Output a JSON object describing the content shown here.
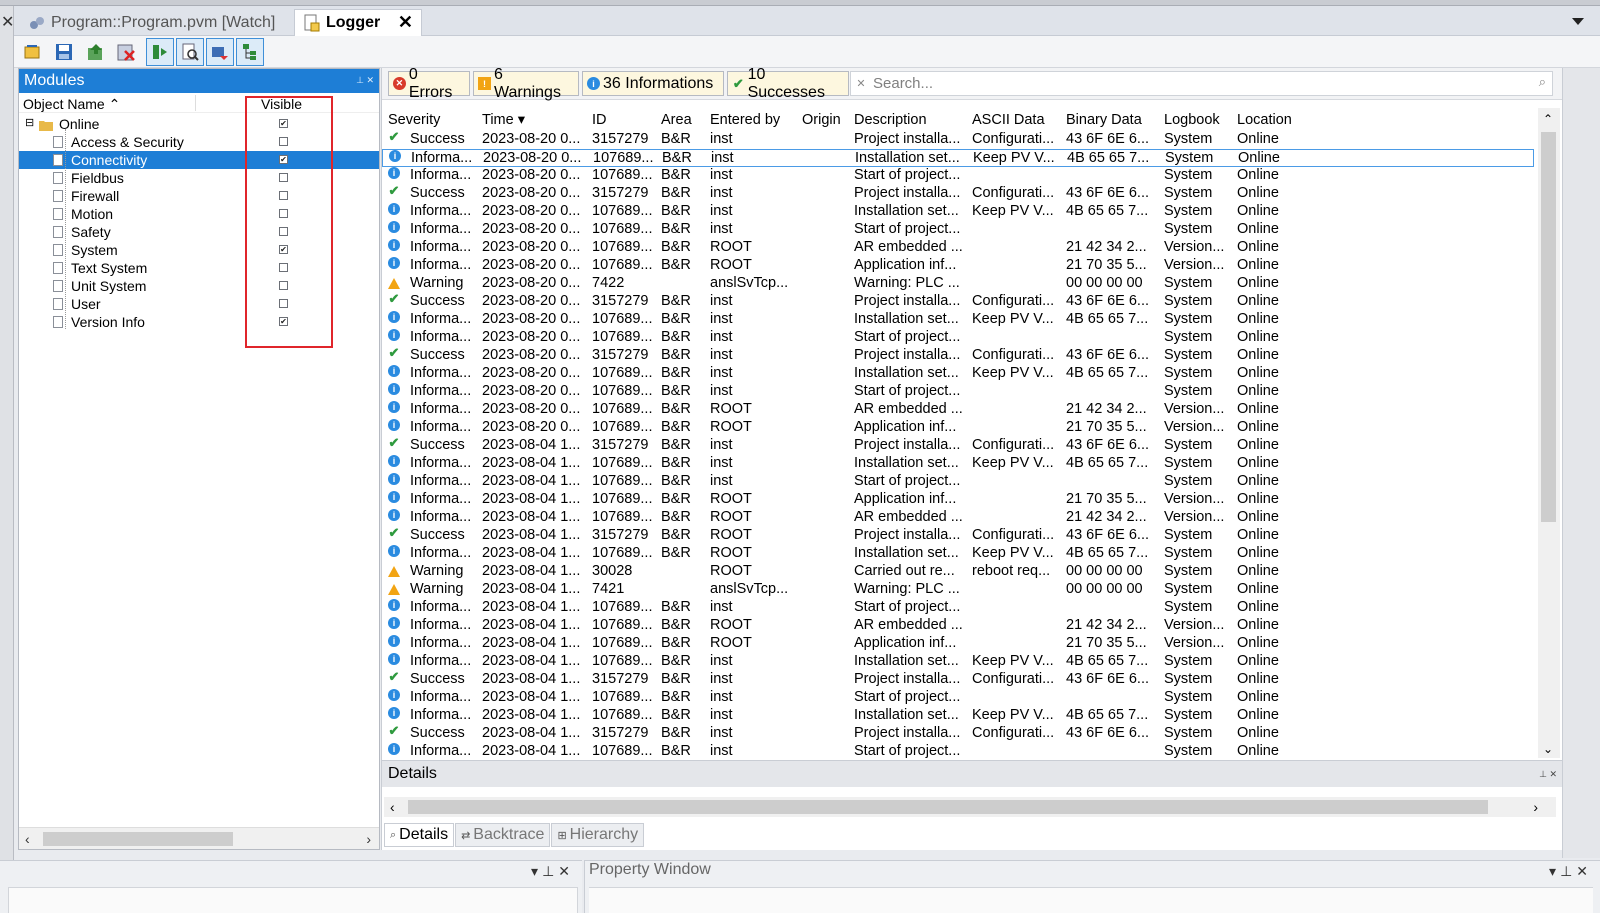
{
  "tabs": {
    "inactive_label": "Program::Program.pvm [Watch]",
    "active_label": "Logger",
    "close": "✕"
  },
  "modules": {
    "title": "Modules",
    "col_name": "Object Name ⌃",
    "col_visible": "Visible",
    "items": [
      {
        "label": "Online",
        "checked": "✔"
      },
      {
        "label": "Access & Security",
        "checked": ""
      },
      {
        "label": "Connectivity",
        "checked": "✔"
      },
      {
        "label": "Fieldbus",
        "checked": ""
      },
      {
        "label": "Firewall",
        "checked": ""
      },
      {
        "label": "Motion",
        "checked": ""
      },
      {
        "label": "Safety",
        "checked": ""
      },
      {
        "label": "System",
        "checked": "✔"
      },
      {
        "label": "Text System",
        "checked": ""
      },
      {
        "label": "Unit System",
        "checked": ""
      },
      {
        "label": "User",
        "checked": ""
      },
      {
        "label": "Version Info",
        "checked": "✔"
      }
    ]
  },
  "filters": {
    "errors": "0 Errors",
    "warnings": "6 Warnings",
    "informations": "36 Informations",
    "successes": "10 Successes",
    "search_placeholder": "Search..."
  },
  "grid": {
    "headers": {
      "severity": "Severity",
      "time": "Time ▾",
      "id": "ID",
      "area": "Area",
      "entered_by": "Entered by",
      "origin": "Origin",
      "description": "Description",
      "ascii": "ASCII Data",
      "binary": "Binary Data",
      "logbook": "Logbook",
      "location": "Location"
    },
    "rows": [
      {
        "sev": "ok",
        "severity": "Success",
        "time": "2023-08-20 0...",
        "id": "3157279",
        "area": "B&R",
        "by": "inst",
        "origin": "",
        "desc": "Project installa...",
        "ascii": "Configurati...",
        "bin": "43 6F 6E 6...",
        "log": "System",
        "loc": "Online"
      },
      {
        "sev": "info",
        "severity": "Informa...",
        "time": "2023-08-20 0...",
        "id": "107689...",
        "area": "B&R",
        "by": "inst",
        "origin": "",
        "desc": "Installation set...",
        "ascii": "Keep PV V...",
        "bin": "4B 65 65 7...",
        "log": "System",
        "loc": "Online"
      },
      {
        "sev": "info",
        "severity": "Informa...",
        "time": "2023-08-20 0...",
        "id": "107689...",
        "area": "B&R",
        "by": "inst",
        "origin": "",
        "desc": "Start of project...",
        "ascii": "",
        "bin": "",
        "log": "System",
        "loc": "Online"
      },
      {
        "sev": "ok",
        "severity": "Success",
        "time": "2023-08-20 0...",
        "id": "3157279",
        "area": "B&R",
        "by": "inst",
        "origin": "",
        "desc": "Project installa...",
        "ascii": "Configurati...",
        "bin": "43 6F 6E 6...",
        "log": "System",
        "loc": "Online"
      },
      {
        "sev": "info",
        "severity": "Informa...",
        "time": "2023-08-20 0...",
        "id": "107689...",
        "area": "B&R",
        "by": "inst",
        "origin": "",
        "desc": "Installation set...",
        "ascii": "Keep PV V...",
        "bin": "4B 65 65 7...",
        "log": "System",
        "loc": "Online"
      },
      {
        "sev": "info",
        "severity": "Informa...",
        "time": "2023-08-20 0...",
        "id": "107689...",
        "area": "B&R",
        "by": "inst",
        "origin": "",
        "desc": "Start of project...",
        "ascii": "",
        "bin": "",
        "log": "System",
        "loc": "Online"
      },
      {
        "sev": "info",
        "severity": "Informa...",
        "time": "2023-08-20 0...",
        "id": "107689...",
        "area": "B&R",
        "by": "ROOT",
        "origin": "",
        "desc": "AR embedded ...",
        "ascii": "",
        "bin": "21 42 34 2...",
        "log": "Version...",
        "loc": "Online"
      },
      {
        "sev": "info",
        "severity": "Informa...",
        "time": "2023-08-20 0...",
        "id": "107689...",
        "area": "B&R",
        "by": "ROOT",
        "origin": "",
        "desc": "Application inf...",
        "ascii": "",
        "bin": "21 70 35 5...",
        "log": "Version...",
        "loc": "Online"
      },
      {
        "sev": "warn",
        "severity": "Warning",
        "time": "2023-08-20 0...",
        "id": "7422",
        "area": "",
        "by": "anslSvTcp...",
        "origin": "",
        "desc": "Warning: PLC ...",
        "ascii": "",
        "bin": "00 00 00 00",
        "log": "System",
        "loc": "Online"
      },
      {
        "sev": "ok",
        "severity": "Success",
        "time": "2023-08-20 0...",
        "id": "3157279",
        "area": "B&R",
        "by": "inst",
        "origin": "",
        "desc": "Project installa...",
        "ascii": "Configurati...",
        "bin": "43 6F 6E 6...",
        "log": "System",
        "loc": "Online"
      },
      {
        "sev": "info",
        "severity": "Informa...",
        "time": "2023-08-20 0...",
        "id": "107689...",
        "area": "B&R",
        "by": "inst",
        "origin": "",
        "desc": "Installation set...",
        "ascii": "Keep PV V...",
        "bin": "4B 65 65 7...",
        "log": "System",
        "loc": "Online"
      },
      {
        "sev": "info",
        "severity": "Informa...",
        "time": "2023-08-20 0...",
        "id": "107689...",
        "area": "B&R",
        "by": "inst",
        "origin": "",
        "desc": "Start of project...",
        "ascii": "",
        "bin": "",
        "log": "System",
        "loc": "Online"
      },
      {
        "sev": "ok",
        "severity": "Success",
        "time": "2023-08-20 0...",
        "id": "3157279",
        "area": "B&R",
        "by": "inst",
        "origin": "",
        "desc": "Project installa...",
        "ascii": "Configurati...",
        "bin": "43 6F 6E 6...",
        "log": "System",
        "loc": "Online"
      },
      {
        "sev": "info",
        "severity": "Informa...",
        "time": "2023-08-20 0...",
        "id": "107689...",
        "area": "B&R",
        "by": "inst",
        "origin": "",
        "desc": "Installation set...",
        "ascii": "Keep PV V...",
        "bin": "4B 65 65 7...",
        "log": "System",
        "loc": "Online"
      },
      {
        "sev": "info",
        "severity": "Informa...",
        "time": "2023-08-20 0...",
        "id": "107689...",
        "area": "B&R",
        "by": "inst",
        "origin": "",
        "desc": "Start of project...",
        "ascii": "",
        "bin": "",
        "log": "System",
        "loc": "Online"
      },
      {
        "sev": "info",
        "severity": "Informa...",
        "time": "2023-08-20 0...",
        "id": "107689...",
        "area": "B&R",
        "by": "ROOT",
        "origin": "",
        "desc": "AR embedded ...",
        "ascii": "",
        "bin": "21 42 34 2...",
        "log": "Version...",
        "loc": "Online"
      },
      {
        "sev": "info",
        "severity": "Informa...",
        "time": "2023-08-20 0...",
        "id": "107689...",
        "area": "B&R",
        "by": "ROOT",
        "origin": "",
        "desc": "Application inf...",
        "ascii": "",
        "bin": "21 70 35 5...",
        "log": "Version...",
        "loc": "Online"
      },
      {
        "sev": "ok",
        "severity": "Success",
        "time": "2023-08-04 1...",
        "id": "3157279",
        "area": "B&R",
        "by": "inst",
        "origin": "",
        "desc": "Project installa...",
        "ascii": "Configurati...",
        "bin": "43 6F 6E 6...",
        "log": "System",
        "loc": "Online"
      },
      {
        "sev": "info",
        "severity": "Informa...",
        "time": "2023-08-04 1...",
        "id": "107689...",
        "area": "B&R",
        "by": "inst",
        "origin": "",
        "desc": "Installation set...",
        "ascii": "Keep PV V...",
        "bin": "4B 65 65 7...",
        "log": "System",
        "loc": "Online"
      },
      {
        "sev": "info",
        "severity": "Informa...",
        "time": "2023-08-04 1...",
        "id": "107689...",
        "area": "B&R",
        "by": "inst",
        "origin": "",
        "desc": "Start of project...",
        "ascii": "",
        "bin": "",
        "log": "System",
        "loc": "Online"
      },
      {
        "sev": "info",
        "severity": "Informa...",
        "time": "2023-08-04 1...",
        "id": "107689...",
        "area": "B&R",
        "by": "ROOT",
        "origin": "",
        "desc": "Application inf...",
        "ascii": "",
        "bin": "21 70 35 5...",
        "log": "Version...",
        "loc": "Online"
      },
      {
        "sev": "info",
        "severity": "Informa...",
        "time": "2023-08-04 1...",
        "id": "107689...",
        "area": "B&R",
        "by": "ROOT",
        "origin": "",
        "desc": "AR embedded ...",
        "ascii": "",
        "bin": "21 42 34 2...",
        "log": "Version...",
        "loc": "Online"
      },
      {
        "sev": "ok",
        "severity": "Success",
        "time": "2023-08-04 1...",
        "id": "3157279",
        "area": "B&R",
        "by": "ROOT",
        "origin": "",
        "desc": "Project installa...",
        "ascii": "Configurati...",
        "bin": "43 6F 6E 6...",
        "log": "System",
        "loc": "Online"
      },
      {
        "sev": "info",
        "severity": "Informa...",
        "time": "2023-08-04 1...",
        "id": "107689...",
        "area": "B&R",
        "by": "ROOT",
        "origin": "",
        "desc": "Installation set...",
        "ascii": "Keep PV V...",
        "bin": "4B 65 65 7...",
        "log": "System",
        "loc": "Online"
      },
      {
        "sev": "warn",
        "severity": "Warning",
        "time": "2023-08-04 1...",
        "id": "30028",
        "area": "",
        "by": "ROOT",
        "origin": "",
        "desc": "Carried out re...",
        "ascii": "reboot req...",
        "bin": "00 00 00 00",
        "log": "System",
        "loc": "Online"
      },
      {
        "sev": "warn",
        "severity": "Warning",
        "time": "2023-08-04 1...",
        "id": "7421",
        "area": "",
        "by": "anslSvTcp...",
        "origin": "",
        "desc": "Warning: PLC ...",
        "ascii": "",
        "bin": "00 00 00 00",
        "log": "System",
        "loc": "Online"
      },
      {
        "sev": "info",
        "severity": "Informa...",
        "time": "2023-08-04 1...",
        "id": "107689...",
        "area": "B&R",
        "by": "inst",
        "origin": "",
        "desc": "Start of project...",
        "ascii": "",
        "bin": "",
        "log": "System",
        "loc": "Online"
      },
      {
        "sev": "info",
        "severity": "Informa...",
        "time": "2023-08-04 1...",
        "id": "107689...",
        "area": "B&R",
        "by": "ROOT",
        "origin": "",
        "desc": "AR embedded ...",
        "ascii": "",
        "bin": "21 42 34 2...",
        "log": "Version...",
        "loc": "Online"
      },
      {
        "sev": "info",
        "severity": "Informa...",
        "time": "2023-08-04 1...",
        "id": "107689...",
        "area": "B&R",
        "by": "ROOT",
        "origin": "",
        "desc": "Application inf...",
        "ascii": "",
        "bin": "21 70 35 5...",
        "log": "Version...",
        "loc": "Online"
      },
      {
        "sev": "info",
        "severity": "Informa...",
        "time": "2023-08-04 1...",
        "id": "107689...",
        "area": "B&R",
        "by": "inst",
        "origin": "",
        "desc": "Installation set...",
        "ascii": "Keep PV V...",
        "bin": "4B 65 65 7...",
        "log": "System",
        "loc": "Online"
      },
      {
        "sev": "ok",
        "severity": "Success",
        "time": "2023-08-04 1...",
        "id": "3157279",
        "area": "B&R",
        "by": "inst",
        "origin": "",
        "desc": "Project installa...",
        "ascii": "Configurati...",
        "bin": "43 6F 6E 6...",
        "log": "System",
        "loc": "Online"
      },
      {
        "sev": "info",
        "severity": "Informa...",
        "time": "2023-08-04 1...",
        "id": "107689...",
        "area": "B&R",
        "by": "inst",
        "origin": "",
        "desc": "Start of project...",
        "ascii": "",
        "bin": "",
        "log": "System",
        "loc": "Online"
      },
      {
        "sev": "info",
        "severity": "Informa...",
        "time": "2023-08-04 1...",
        "id": "107689...",
        "area": "B&R",
        "by": "inst",
        "origin": "",
        "desc": "Installation set...",
        "ascii": "Keep PV V...",
        "bin": "4B 65 65 7...",
        "log": "System",
        "loc": "Online"
      },
      {
        "sev": "ok",
        "severity": "Success",
        "time": "2023-08-04 1...",
        "id": "3157279",
        "area": "B&R",
        "by": "inst",
        "origin": "",
        "desc": "Project installa...",
        "ascii": "Configurati...",
        "bin": "43 6F 6E 6...",
        "log": "System",
        "loc": "Online"
      },
      {
        "sev": "info",
        "severity": "Informa...",
        "time": "2023-08-04 1...",
        "id": "107689...",
        "area": "B&R",
        "by": "inst",
        "origin": "",
        "desc": "Start of project...",
        "ascii": "",
        "bin": "",
        "log": "System",
        "loc": "Online"
      }
    ]
  },
  "details": {
    "title": "Details",
    "tabs": [
      "Details",
      "Backtrace",
      "Hierarchy"
    ]
  },
  "bottom": {
    "property_title": "Property Window"
  }
}
